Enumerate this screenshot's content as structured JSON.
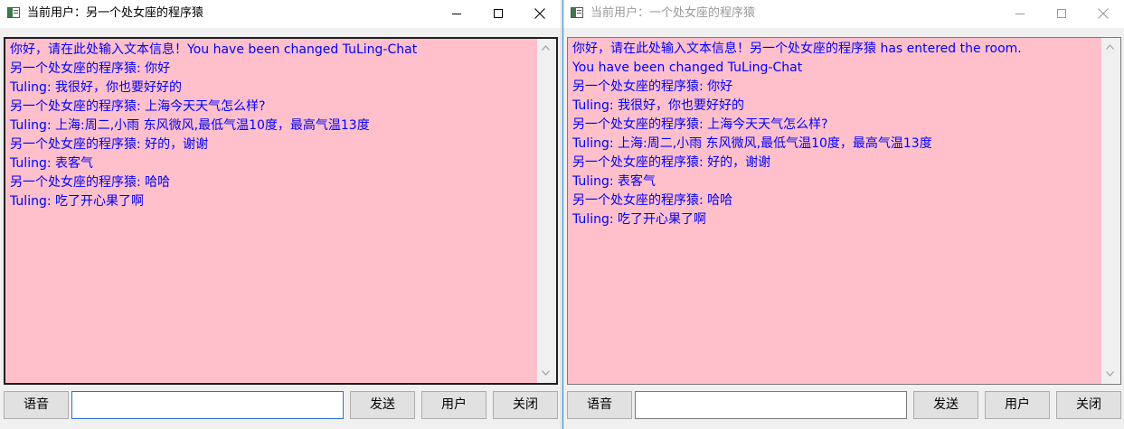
{
  "windows": {
    "left": {
      "title": "当前用户：另一个处女座的程序猿",
      "chat_lines": [
        "你好，请在此处输入文本信息！You have been changed TuLing-Chat",
        "另一个处女座的程序猿: 你好",
        "Tuling: 我很好，你也要好好的",
        "另一个处女座的程序猿: 上海今天天气怎么样?",
        "Tuling: 上海:周二,小雨 东风微风,最低气温10度，最高气温13度",
        "另一个处女座的程序猿: 好的，谢谢",
        "Tuling: 表客气",
        "另一个处女座的程序猿: 哈哈",
        "Tuling: 吃了开心果了啊"
      ],
      "input_value": "",
      "buttons": {
        "voice": "语音",
        "send": "发送",
        "user": "用户",
        "close": "关闭"
      }
    },
    "right": {
      "title": "当前用户：一个处女座的程序猿",
      "chat_lines": [
        "你好，请在此处输入文本信息！另一个处女座的程序猿 has entered the room.",
        "You have been changed TuLing-Chat",
        "另一个处女座的程序猿: 你好",
        "Tuling: 我很好，你也要好好的",
        "另一个处女座的程序猿: 上海今天天气怎么样?",
        "Tuling: 上海:周二,小雨 东风微风,最低气温10度，最高气温13度",
        "另一个处女座的程序猿: 好的，谢谢",
        "Tuling: 表客气",
        "另一个处女座的程序猿: 哈哈",
        "Tuling: 吃了开心果了啊"
      ],
      "input_value": "",
      "buttons": {
        "voice": "语音",
        "send": "发送",
        "user": "用户",
        "close": "关闭"
      }
    }
  },
  "colors": {
    "chat_background": "#ffc0cb",
    "chat_text": "#0000ff",
    "active_border": "#1979ca"
  },
  "icons": {
    "app": "app-window-icon",
    "minimize": "minimize-icon",
    "maximize": "maximize-icon",
    "close": "close-icon"
  }
}
